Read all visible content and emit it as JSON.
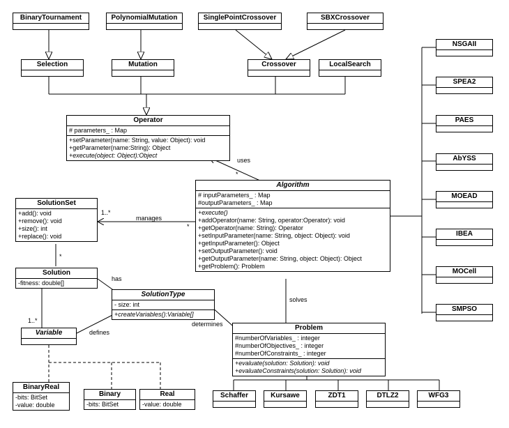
{
  "top": {
    "binaryTournament": "BinaryTournament",
    "polynomialMutation": "PolynomialMutation",
    "singlePointCrossover": "SinglePointCrossover",
    "sbxCrossover": "SBXCrossover",
    "selection": "Selection",
    "mutation": "Mutation",
    "crossover": "Crossover",
    "localSearch": "LocalSearch"
  },
  "operator": {
    "title": "Operator",
    "attr1": "# parameters_ : Map",
    "op1": "+setParameter(name: String, value: Object): void",
    "op2": "+getParameter(name:String): Object",
    "op3": "+execute(object: Object):Object"
  },
  "algorithm": {
    "title": "Algorithm",
    "attr1": "# inputParameters_ : Map",
    "attr2": "#outputParameters_ : Map",
    "op1": "+execute()",
    "op2": "+addOperator(name: String, operator:Operator): void",
    "op3": "+getOperator(name: String): Operator",
    "op4": "+setInputParameter(name: String, object: Object): void",
    "op5": "+getInputParameter(): Object",
    "op6": "+setOutputParameter(): void",
    "op7": "+getOutputParameter(name: String, object: Object): Object",
    "op8": "+getProblem(): Problem"
  },
  "solutionSet": {
    "title": "SolutionSet",
    "op1": "+add(): void",
    "op2": "+remove(): void",
    "op3": "+size(): int",
    "op4": "+replace(): void"
  },
  "solution": {
    "title": "Solution",
    "attr1": "-fitness: double[]"
  },
  "solutionType": {
    "title": "SolutionType",
    "attr1": "- size: int",
    "op1": "+createVariables():Variable[]"
  },
  "variable": {
    "title": "Variable"
  },
  "problem": {
    "title": "Problem",
    "attr1": "#numberOfVariables_ : integer",
    "attr2": "#numberOfObjectives_ : integer",
    "attr3": "#numberOfConstraints_ : integer",
    "op1": "+evaluate(solution: Solution): void",
    "op2": "+evaluateConstraints(solution: Solution): void"
  },
  "variableSubs": {
    "binaryReal": {
      "title": "BinaryReal",
      "a1": "-bits: BitSet",
      "a2": "-value: double"
    },
    "binary": {
      "title": "Binary",
      "a1": "-bits: BitSet"
    },
    "real": {
      "title": "Real",
      "a1": "-value: double"
    }
  },
  "problemSubs": {
    "schaffer": "Schaffer",
    "kursawe": "Kursawe",
    "zdt1": "ZDT1",
    "dtlz2": "DTLZ2",
    "wfg3": "WFG3"
  },
  "algoSubs": {
    "nsgaii": "NSGAII",
    "spea2": "SPEA2",
    "paes": "PAES",
    "abyss": "AbYSS",
    "moead": "MOEAD",
    "ibea": "IBEA",
    "mocell": "MOCell",
    "smpso": "SMPSO"
  },
  "labels": {
    "uses": "uses",
    "manages": "manages",
    "has": "has",
    "defines": "defines",
    "determines": "determines",
    "solves": "solves",
    "oneStar1": "1..*",
    "star1": "*",
    "star2": "*",
    "star3": "*",
    "oneStar2": "1..*"
  }
}
